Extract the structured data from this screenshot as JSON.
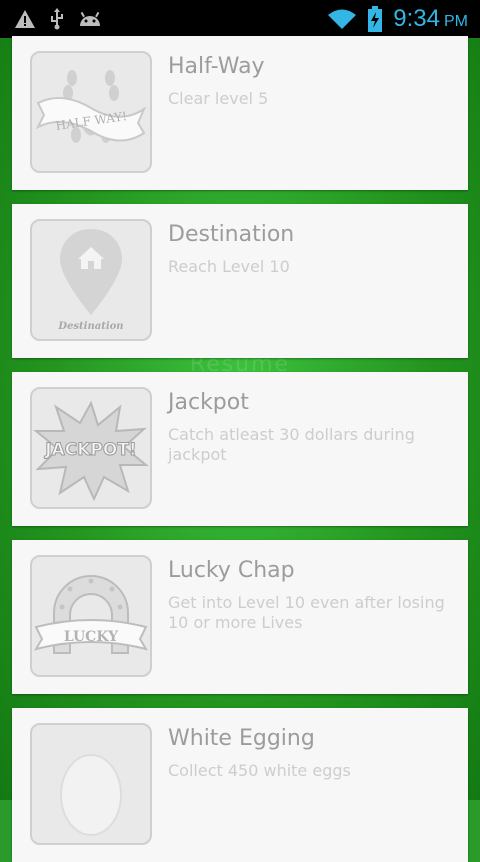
{
  "status_bar": {
    "time": "9:34",
    "ampm": "PM"
  },
  "background": {
    "resume_text": "Resume"
  },
  "achievements": [
    {
      "title": "Half-Way",
      "description": "Clear level 5",
      "badge_text": "HALF WAY!"
    },
    {
      "title": "Destination",
      "description": "Reach Level 10",
      "badge_text": "Destination"
    },
    {
      "title": "Jackpot",
      "description": "Catch atleast 30 dollars during jackpot",
      "badge_text": "JACKPOT!"
    },
    {
      "title": "Lucky Chap",
      "description": "Get into Level 10 even after losing 10 or more Lives",
      "badge_text": "LUCKY"
    },
    {
      "title": "White Egging",
      "description": "Collect 450 white eggs",
      "badge_text": ""
    }
  ],
  "colors": {
    "status_blue": "#33b5e5",
    "green_bg": "#2a9a2a",
    "card_bg": "#f7f7f7"
  }
}
